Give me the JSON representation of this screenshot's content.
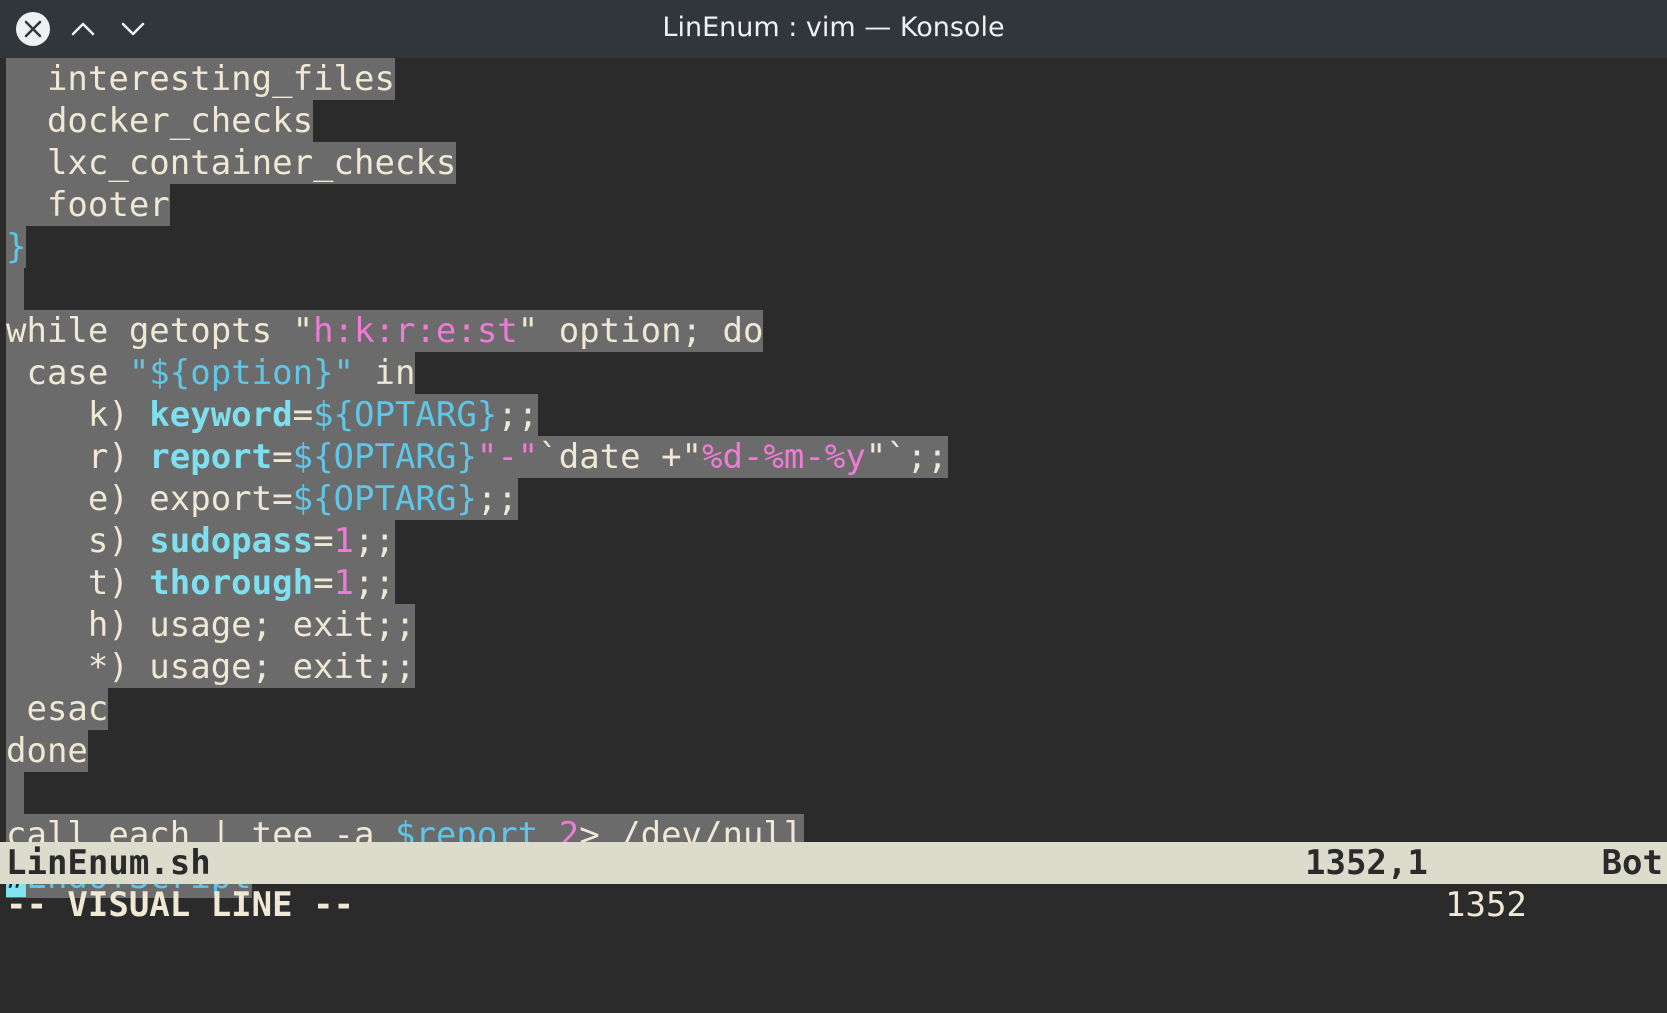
{
  "window": {
    "title": "LinEnum : vim — Konsole"
  },
  "titlebar_buttons": [
    {
      "name": "close-button",
      "icon": "close-icon"
    },
    {
      "name": "scroll-up-button",
      "icon": "chevron-up-icon"
    },
    {
      "name": "scroll-down-button",
      "icon": "chevron-down-icon"
    }
  ],
  "editor": {
    "lines": [
      [
        "  interesting_files"
      ],
      [
        "  docker_checks"
      ],
      [
        "  lxc_container_checks"
      ],
      [
        "  footer"
      ],
      [
        "}"
      ],
      [
        " "
      ],
      [
        "while getopts ",
        "\"",
        "h:k:r:e:st",
        "\"",
        " option; do"
      ],
      [
        " case ",
        "\"${option}\"",
        " in"
      ],
      [
        "    k) ",
        "keyword",
        "=",
        "${OPTARG}",
        ";;"
      ],
      [
        "    r) ",
        "report",
        "=",
        "${OPTARG}",
        "\"-\"",
        "`date +\"",
        "%d-%m-%y",
        "\"`",
        ";;"
      ],
      [
        "    e) export=",
        "${OPTARG}",
        ";;"
      ],
      [
        "    s) ",
        "sudopass",
        "=",
        "1",
        ";;"
      ],
      [
        "    t) ",
        "thorough",
        "=",
        "1",
        ";;"
      ],
      [
        "    h) usage; exit;;"
      ],
      [
        "    *) usage; exit;;"
      ],
      [
        " esac"
      ],
      [
        "done"
      ],
      [
        " "
      ],
      [
        "call_each | tee -a ",
        "$report",
        " ",
        "2",
        "> /dev/null"
      ],
      [
        "#",
        "EndOfScript"
      ]
    ]
  },
  "statusline": {
    "filename": "LinEnum.sh",
    "position": "1352,1",
    "scroll": "Bot"
  },
  "cmdline": {
    "mode": "-- VISUAL LINE --",
    "selection_count": "1352"
  },
  "colors": {
    "background": "#2b2b2b",
    "selection": "#6b6b6b",
    "text": "#eee8d5",
    "cyan": "#5fc6e8",
    "pink": "#ee7bd6",
    "statusline_bg": "#dcdccc",
    "titlebar_bg": "#31363b"
  }
}
